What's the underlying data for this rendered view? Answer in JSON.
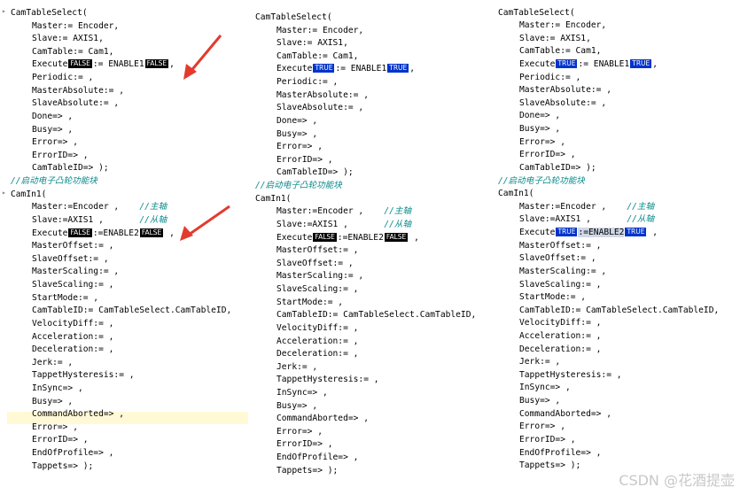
{
  "watermark": "CSDN @花酒提壶",
  "colors": {
    "badge_false_bg": "#000000",
    "badge_true_bg": "#0033cc",
    "comment": "#0a8a8a",
    "arrow": "#e23b2e"
  },
  "panes": [
    {
      "id": "left",
      "block1": {
        "header": "CamTableSelect(",
        "master": "Master:= Encoder,",
        "slave": "Slave:= AXIS1,",
        "camtable": "CamTable:= Cam1,",
        "exec_pre": "Execute",
        "exec_badge1": "FALSE",
        "exec_mid": ":= ENABLE1",
        "exec_badge2": "FALSE",
        "exec_post": ",",
        "periodic": "Periodic:= ,",
        "masterabs": "MasterAbsolute:= ,",
        "slaveabs": "SlaveAbsolute:= ,",
        "done": "Done=> ,",
        "busy": "Busy=> ,",
        "error": "Error=> ,",
        "errorid": "ErrorID=> ,",
        "camtableid": "CamTableID=> );"
      },
      "comment": "//启动电子凸轮功能块",
      "block2": {
        "header": "CamIn1(",
        "master": "Master:=Encoder ,",
        "master_cmt": "//主轴",
        "slave": "Slave:=AXIS1 ,",
        "slave_cmt": "//从轴",
        "exec_pre": "Execute",
        "exec_badge1": "FALSE",
        "exec_mid": ":=ENABLE2",
        "exec_badge2": "FALSE",
        "exec_post": " ,",
        "masteroffset": "MasterOffset:= ,",
        "slaveoffset": "SlaveOffset:= ,",
        "masterscaling": "MasterScaling:= ,",
        "slavescaling": "SlaveScaling:= ,",
        "startmode": "StartMode:= ,",
        "camtableid": "CamTableID:= CamTableSelect.CamTableID,",
        "velocitydiff": "VelocityDiff:= ,",
        "acceleration": "Acceleration:= ,",
        "deceleration": "Deceleration:= ,",
        "jerk": "Jerk:= ,",
        "tappet": "TappetHysteresis:= ,",
        "insync": "InSync=> ,",
        "busy": "Busy=> ,",
        "cmdaborted": "CommandAborted=> ,",
        "error": "Error=> ,",
        "errorid": "ErrorID=> ,",
        "endofprofile": "EndOfProfile=> ,",
        "tappets": "Tappets=> );"
      }
    },
    {
      "id": "middle",
      "block1": {
        "header": "CamTableSelect(",
        "master": "Master:= Encoder,",
        "slave": "Slave:= AXIS1,",
        "camtable": "CamTable:= Cam1,",
        "exec_pre": "Execute",
        "exec_badge1": "TRUE",
        "exec_mid": ":= ENABLE1",
        "exec_badge2": "TRUE",
        "exec_post": ",",
        "periodic": "Periodic:= ,",
        "masterabs": "MasterAbsolute:= ,",
        "slaveabs": "SlaveAbsolute:= ,",
        "done": "Done=> ,",
        "busy": "Busy=> ,",
        "error": "Error=> ,",
        "errorid": "ErrorID=> ,",
        "camtableid": "CamTableID=> );"
      },
      "comment": "//启动电子凸轮功能块",
      "block2": {
        "header": "CamIn1(",
        "master": "Master:=Encoder ,",
        "master_cmt": "//主轴",
        "slave": "Slave:=AXIS1 ,",
        "slave_cmt": "//从轴",
        "exec_pre": "Execute",
        "exec_badge1": "FALSE",
        "exec_mid": ":=ENABLE2",
        "exec_badge2": "FALSE",
        "exec_post": " ,",
        "masteroffset": "MasterOffset:= ,",
        "slaveoffset": "SlaveOffset:= ,",
        "masterscaling": "MasterScaling:= ,",
        "slavescaling": "SlaveScaling:= ,",
        "startmode": "StartMode:= ,",
        "camtableid": "CamTableID:= CamTableSelect.CamTableID,",
        "velocitydiff": "VelocityDiff:= ,",
        "acceleration": "Acceleration:= ,",
        "deceleration": "Deceleration:= ,",
        "jerk": "Jerk:= ,",
        "tappet": "TappetHysteresis:= ,",
        "insync": "InSync=> ,",
        "busy": "Busy=> ,",
        "cmdaborted": "CommandAborted=> ,",
        "error": "Error=> ,",
        "errorid": "ErrorID=> ,",
        "endofprofile": "EndOfProfile=> ,",
        "tappets": "Tappets=> );"
      }
    },
    {
      "id": "right",
      "block1": {
        "header": "CamTableSelect(",
        "master": "Master:= Encoder,",
        "slave": "Slave:= AXIS1,",
        "camtable": "CamTable:= Cam1,",
        "exec_pre": "Execute",
        "exec_badge1": "TRUE",
        "exec_mid": ":= ENABLE1",
        "exec_badge2": "TRUE",
        "exec_post": ",",
        "periodic": "Periodic:= ,",
        "masterabs": "MasterAbsolute:= ,",
        "slaveabs": "SlaveAbsolute:= ,",
        "done": "Done=> ,",
        "busy": "Busy=> ,",
        "error": "Error=> ,",
        "errorid": "ErrorID=> ,",
        "camtableid": "CamTableID=> );"
      },
      "comment": "//启动电子凸轮功能块",
      "block2": {
        "header": "CamIn1(",
        "master": "Master:=Encoder ,",
        "master_cmt": "//主轴",
        "slave": "Slave:=AXIS1 ,",
        "slave_cmt": "//从轴",
        "exec_pre": "Execute",
        "exec_badge1": "TRUE",
        "exec_mid": ":=ENABLE2",
        "exec_badge2": "TRUE",
        "exec_post": " ,",
        "masteroffset": "MasterOffset:= ,",
        "slaveoffset": "SlaveOffset:= ,",
        "masterscaling": "MasterScaling:= ,",
        "slavescaling": "SlaveScaling:= ,",
        "startmode": "StartMode:= ,",
        "camtableid": "CamTableID:= CamTableSelect.CamTableID,",
        "velocitydiff": "VelocityDiff:= ,",
        "acceleration": "Acceleration:= ,",
        "deceleration": "Deceleration:= ,",
        "jerk": "Jerk:= ,",
        "tappet": "TappetHysteresis:= ,",
        "insync": "InSync=> ,",
        "busy": "Busy=> ,",
        "cmdaborted": "CommandAborted=> ,",
        "error": "Error=> ,",
        "errorid": "ErrorID=> ,",
        "endofprofile": "EndOfProfile=> ,",
        "tappets": "Tappets=> );"
      }
    }
  ]
}
